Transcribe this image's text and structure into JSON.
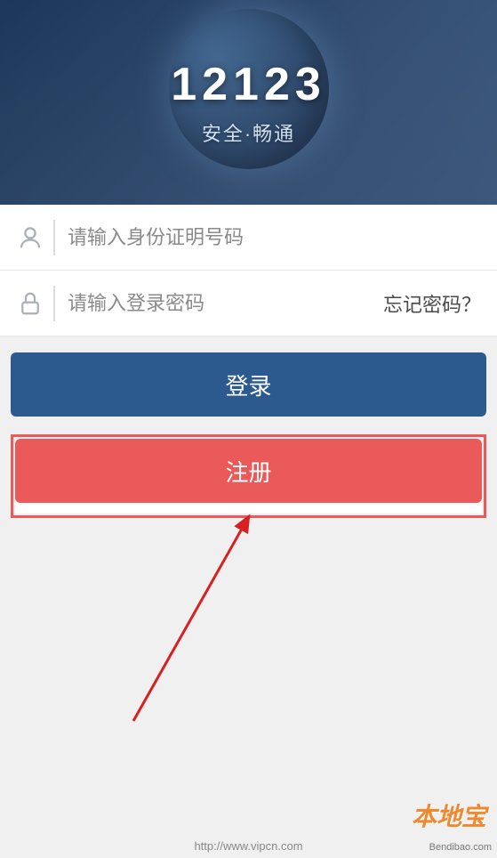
{
  "banner": {
    "title": "12123",
    "subtitle": "安全·畅通"
  },
  "inputs": {
    "id_placeholder": "请输入身份证明号码",
    "password_placeholder": "请输入登录密码",
    "forgot_label": "忘记密码？"
  },
  "buttons": {
    "login_label": "登录",
    "register_label": "注册"
  },
  "watermarks": {
    "logo": "本地宝",
    "domain": "Bendibao.com",
    "url": "http://www.vipcn.com"
  }
}
